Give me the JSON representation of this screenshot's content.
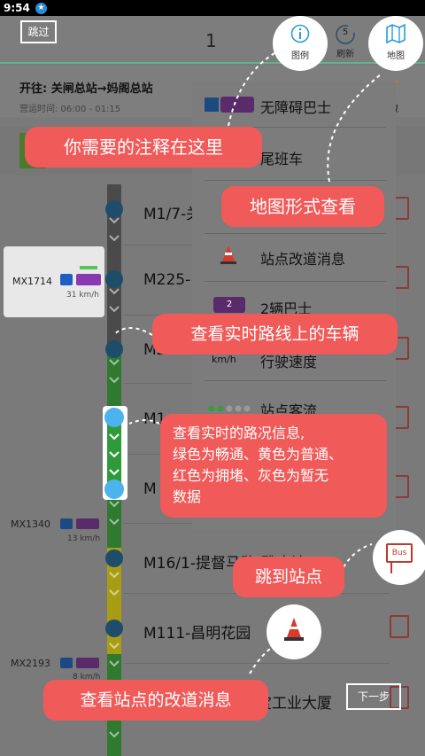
{
  "status_bar": {
    "time": "9:54",
    "indicator": "★"
  },
  "header": {
    "skip_label": "跳过",
    "route_number": "1"
  },
  "route_info": {
    "destination": "开往: 关闸总站→妈阁总站",
    "hours": "营运时间: 06:00 - 01:15"
  },
  "top_buttons": [
    {
      "label": "图例",
      "icon": "info-icon"
    },
    {
      "label": "刷新",
      "icon": "refresh-icon",
      "badge": "5"
    },
    {
      "label": "地图",
      "icon": "map-icon"
    }
  ],
  "legend": {
    "items": [
      {
        "label": "无障碍巴士",
        "icon": "wheelchair-icon"
      },
      {
        "label": "尾班车",
        "icon": "last-bus-icon"
      },
      {
        "label": "站点改道消息",
        "icon": "cone-icon"
      },
      {
        "label": "2辆巴士",
        "icon": "bus-count-icon",
        "badge": "2"
      },
      {
        "label": "行驶速度",
        "icon": "speed-icon",
        "unit": "km/h"
      },
      {
        "label": "站点客流",
        "icon": "crowd-icon"
      }
    ]
  },
  "stops": [
    {
      "name": "M1/7-关"
    },
    {
      "name": "M225-"
    },
    {
      "name": "M226"
    },
    {
      "name": "M1"
    },
    {
      "name": "M"
    },
    {
      "name": "M16/1-提督马路/雅廉访"
    },
    {
      "name": "M111-昌明花园"
    },
    {
      "name": "宝工业大厦"
    }
  ],
  "vehicles": [
    {
      "plate": "MX1714",
      "speed": "31 km/h"
    },
    {
      "plate": "MX1340",
      "speed": "13 km/h"
    },
    {
      "plate": "MX2193",
      "speed": "8 km/h"
    }
  ],
  "tooltips": {
    "annotation": "你需要的注释在这里",
    "map": "地图形式查看",
    "realtime_vehicle": "查看实时路线上的车辆",
    "traffic_info": "查看实时的路况信息,\n绿色为畅通、黄色为普通、\n红色为拥堵、灰色为暂无\n数据",
    "jump_stop": "跳到站点",
    "detour": "查看站点的改道消息"
  },
  "bus_sign_text": "Bus",
  "next_label": "下一步",
  "colors": {
    "accent_red": "#f05a59",
    "node_blue": "#1e4d6b",
    "highlight_blue": "#4db3ef",
    "traffic_green": "#2f7a2f",
    "traffic_yellow": "#a89d12",
    "traffic_gray": "#4a4a4a"
  }
}
